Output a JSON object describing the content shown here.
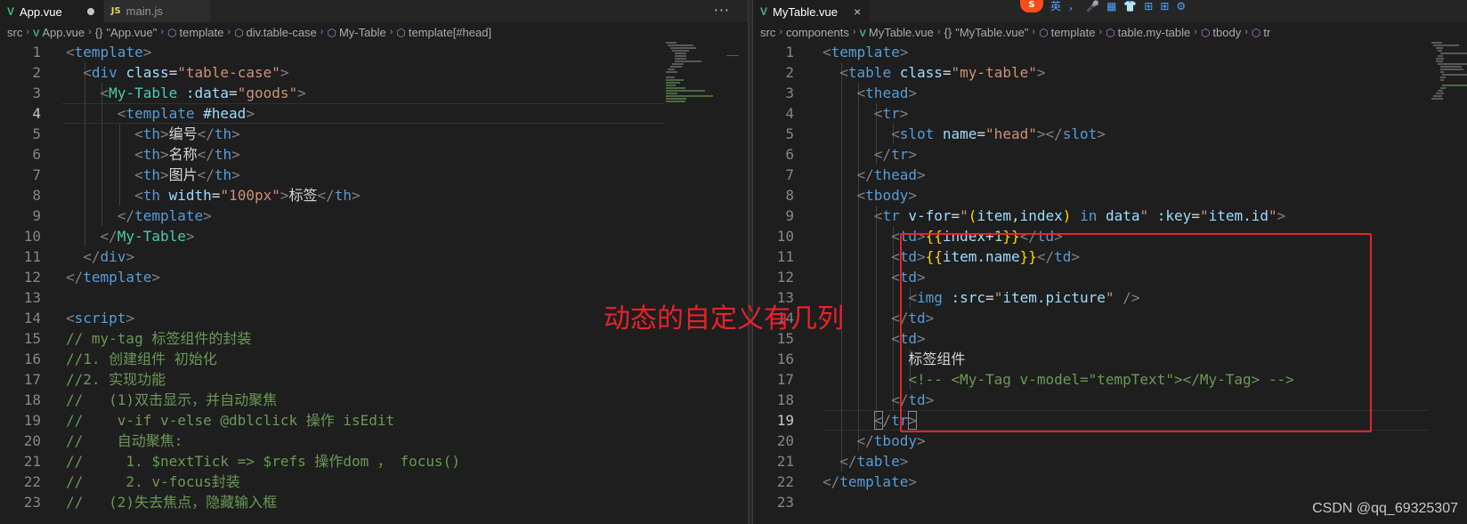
{
  "left": {
    "tabs": [
      {
        "label": "App.vue",
        "icon": "V",
        "modified": true,
        "active": true
      },
      {
        "label": "main.js",
        "icon": "JS",
        "active": false
      }
    ],
    "more": "···",
    "breadcrumb": [
      {
        "text": "src",
        "kind": "plain"
      },
      {
        "text": "App.vue",
        "kind": "vue"
      },
      {
        "text": "\"App.vue\"",
        "kind": "brace"
      },
      {
        "text": "template",
        "kind": "cube"
      },
      {
        "text": "div.table-case",
        "kind": "cube"
      },
      {
        "text": "My-Table",
        "kind": "cube"
      },
      {
        "text": "template[#head]",
        "kind": "cube"
      }
    ],
    "current_line": 4,
    "lines": [
      {
        "n": "1",
        "t": [
          [
            "br",
            "<"
          ],
          [
            "tag",
            "template"
          ],
          [
            "br",
            ">"
          ]
        ]
      },
      {
        "n": "2",
        "t": [
          [
            "txt",
            "  "
          ],
          [
            "br",
            "<"
          ],
          [
            "tag",
            "div"
          ],
          [
            "txt",
            " "
          ],
          [
            "attr",
            "class"
          ],
          [
            "txt",
            "="
          ],
          [
            "str",
            "\"table-case\""
          ],
          [
            "br",
            ">"
          ]
        ]
      },
      {
        "n": "3",
        "t": [
          [
            "txt",
            "    "
          ],
          [
            "br",
            "<"
          ],
          [
            "comp",
            "My-Table"
          ],
          [
            "txt",
            " "
          ],
          [
            "attr",
            ":data"
          ],
          [
            "txt",
            "="
          ],
          [
            "str",
            "\"goods\""
          ],
          [
            "br",
            ">"
          ]
        ]
      },
      {
        "n": "4",
        "t": [
          [
            "txt",
            "      "
          ],
          [
            "br",
            "<"
          ],
          [
            "tag",
            "template"
          ],
          [
            "txt",
            " "
          ],
          [
            "attr",
            "#head"
          ],
          [
            "br",
            ">"
          ]
        ]
      },
      {
        "n": "5",
        "t": [
          [
            "txt",
            "        "
          ],
          [
            "br",
            "<"
          ],
          [
            "tag",
            "th"
          ],
          [
            "br",
            ">"
          ],
          [
            "txt",
            "编号"
          ],
          [
            "br",
            "</"
          ],
          [
            "tag",
            "th"
          ],
          [
            "br",
            ">"
          ]
        ]
      },
      {
        "n": "6",
        "t": [
          [
            "txt",
            "        "
          ],
          [
            "br",
            "<"
          ],
          [
            "tag",
            "th"
          ],
          [
            "br",
            ">"
          ],
          [
            "txt",
            "名称"
          ],
          [
            "br",
            "</"
          ],
          [
            "tag",
            "th"
          ],
          [
            "br",
            ">"
          ]
        ]
      },
      {
        "n": "7",
        "t": [
          [
            "txt",
            "        "
          ],
          [
            "br",
            "<"
          ],
          [
            "tag",
            "th"
          ],
          [
            "br",
            ">"
          ],
          [
            "txt",
            "图片"
          ],
          [
            "br",
            "</"
          ],
          [
            "tag",
            "th"
          ],
          [
            "br",
            ">"
          ]
        ]
      },
      {
        "n": "8",
        "t": [
          [
            "txt",
            "        "
          ],
          [
            "br",
            "<"
          ],
          [
            "tag",
            "th"
          ],
          [
            "txt",
            " "
          ],
          [
            "attr",
            "width"
          ],
          [
            "txt",
            "="
          ],
          [
            "str",
            "\"100px\""
          ],
          [
            "br",
            ">"
          ],
          [
            "txt",
            "标签"
          ],
          [
            "br",
            "</"
          ],
          [
            "tag",
            "th"
          ],
          [
            "br",
            ">"
          ]
        ]
      },
      {
        "n": "9",
        "t": [
          [
            "txt",
            "      "
          ],
          [
            "br",
            "</"
          ],
          [
            "tag",
            "template"
          ],
          [
            "br",
            ">"
          ]
        ]
      },
      {
        "n": "10",
        "t": [
          [
            "txt",
            "    "
          ],
          [
            "br",
            "</"
          ],
          [
            "comp",
            "My-Table"
          ],
          [
            "br",
            ">"
          ]
        ]
      },
      {
        "n": "11",
        "t": [
          [
            "txt",
            "  "
          ],
          [
            "br",
            "</"
          ],
          [
            "tag",
            "div"
          ],
          [
            "br",
            ">"
          ]
        ]
      },
      {
        "n": "12",
        "t": [
          [
            "br",
            "</"
          ],
          [
            "tag",
            "template"
          ],
          [
            "br",
            ">"
          ]
        ]
      },
      {
        "n": "13",
        "t": []
      },
      {
        "n": "14",
        "t": [
          [
            "br",
            "<"
          ],
          [
            "tag",
            "script"
          ],
          [
            "br",
            ">"
          ]
        ]
      },
      {
        "n": "15",
        "t": [
          [
            "com",
            "// my-tag 标签组件的封装"
          ]
        ]
      },
      {
        "n": "16",
        "t": [
          [
            "com",
            "//1. 创建组件 初始化"
          ]
        ]
      },
      {
        "n": "17",
        "t": [
          [
            "com",
            "//2. 实现功能"
          ]
        ]
      },
      {
        "n": "18",
        "t": [
          [
            "com",
            "//   (1)双击显示，并自动聚焦"
          ]
        ]
      },
      {
        "n": "19",
        "t": [
          [
            "com",
            "//    v-if v-else @dblclick 操作 isEdit"
          ]
        ]
      },
      {
        "n": "20",
        "t": [
          [
            "com",
            "//    自动聚焦:"
          ]
        ]
      },
      {
        "n": "21",
        "t": [
          [
            "com",
            "//     1. $nextTick => $refs 操作dom ， focus()"
          ]
        ]
      },
      {
        "n": "22",
        "t": [
          [
            "com",
            "//     2. v-focus封装"
          ]
        ]
      },
      {
        "n": "23",
        "t": [
          [
            "com",
            "//   (2)失去焦点，隐藏输入框"
          ]
        ]
      }
    ]
  },
  "right": {
    "tabs": [
      {
        "label": "MyTable.vue",
        "icon": "V",
        "active": true
      }
    ],
    "close": "×",
    "ime": {
      "logo": "S",
      "items": [
        "英",
        "，",
        "🎤",
        "▦",
        "👕",
        "⊞",
        "⊞",
        "⚙"
      ]
    },
    "breadcrumb": [
      {
        "text": "src",
        "kind": "plain"
      },
      {
        "text": "components",
        "kind": "plain"
      },
      {
        "text": "MyTable.vue",
        "kind": "vue"
      },
      {
        "text": "\"MyTable.vue\"",
        "kind": "brace"
      },
      {
        "text": "template",
        "kind": "cube"
      },
      {
        "text": "table.my-table",
        "kind": "cube"
      },
      {
        "text": "tbody",
        "kind": "cube"
      },
      {
        "text": "tr",
        "kind": "cube"
      }
    ],
    "current_line": 19,
    "lines": [
      {
        "n": "1",
        "t": [
          [
            "br",
            "<"
          ],
          [
            "tag",
            "template"
          ],
          [
            "br",
            ">"
          ]
        ]
      },
      {
        "n": "2",
        "t": [
          [
            "txt",
            "  "
          ],
          [
            "br",
            "<"
          ],
          [
            "tag",
            "table"
          ],
          [
            "txt",
            " "
          ],
          [
            "attr",
            "class"
          ],
          [
            "txt",
            "="
          ],
          [
            "str",
            "\"my-table\""
          ],
          [
            "br",
            ">"
          ]
        ]
      },
      {
        "n": "3",
        "t": [
          [
            "txt",
            "    "
          ],
          [
            "br",
            "<"
          ],
          [
            "tag",
            "thead"
          ],
          [
            "br",
            ">"
          ]
        ]
      },
      {
        "n": "4",
        "t": [
          [
            "txt",
            "      "
          ],
          [
            "br",
            "<"
          ],
          [
            "tag",
            "tr"
          ],
          [
            "br",
            ">"
          ]
        ]
      },
      {
        "n": "5",
        "t": [
          [
            "txt",
            "        "
          ],
          [
            "br",
            "<"
          ],
          [
            "tag",
            "slot"
          ],
          [
            "txt",
            " "
          ],
          [
            "attr",
            "name"
          ],
          [
            "txt",
            "="
          ],
          [
            "str",
            "\"head\""
          ],
          [
            "br",
            "></"
          ],
          [
            "tag",
            "slot"
          ],
          [
            "br",
            ">"
          ]
        ]
      },
      {
        "n": "6",
        "t": [
          [
            "txt",
            "      "
          ],
          [
            "br",
            "</"
          ],
          [
            "tag",
            "tr"
          ],
          [
            "br",
            ">"
          ]
        ]
      },
      {
        "n": "7",
        "t": [
          [
            "txt",
            "    "
          ],
          [
            "br",
            "</"
          ],
          [
            "tag",
            "thead"
          ],
          [
            "br",
            ">"
          ]
        ]
      },
      {
        "n": "8",
        "t": [
          [
            "txt",
            "    "
          ],
          [
            "br",
            "<"
          ],
          [
            "tag",
            "tbody"
          ],
          [
            "br",
            ">"
          ]
        ]
      },
      {
        "n": "9",
        "t": [
          [
            "txt",
            "      "
          ],
          [
            "br",
            "<"
          ],
          [
            "tag",
            "tr"
          ],
          [
            "txt",
            " "
          ],
          [
            "attr",
            "v-for"
          ],
          [
            "txt",
            "="
          ],
          [
            "str",
            "\""
          ],
          [
            "mus",
            "("
          ],
          [
            "var",
            "item"
          ],
          [
            "txt",
            ","
          ],
          [
            "var",
            "index"
          ],
          [
            "mus",
            ")"
          ],
          [
            "txt",
            " "
          ],
          [
            "kw",
            "in"
          ],
          [
            "txt",
            " "
          ],
          [
            "var",
            "data"
          ],
          [
            "str",
            "\""
          ],
          [
            "txt",
            " "
          ],
          [
            "attr",
            ":key"
          ],
          [
            "txt",
            "="
          ],
          [
            "str",
            "\""
          ],
          [
            "var",
            "item.id"
          ],
          [
            "str",
            "\""
          ],
          [
            "br",
            ">"
          ]
        ]
      },
      {
        "n": "10",
        "t": [
          [
            "txt",
            "        "
          ],
          [
            "br",
            "<"
          ],
          [
            "tag",
            "td"
          ],
          [
            "br",
            ">"
          ],
          [
            "mus",
            "{{"
          ],
          [
            "var",
            "index"
          ],
          [
            "txt",
            "+"
          ],
          [
            "num",
            "1"
          ],
          [
            "mus",
            "}}"
          ],
          [
            "br",
            "</"
          ],
          [
            "tag",
            "td"
          ],
          [
            "br",
            ">"
          ]
        ]
      },
      {
        "n": "11",
        "t": [
          [
            "txt",
            "        "
          ],
          [
            "br",
            "<"
          ],
          [
            "tag",
            "td"
          ],
          [
            "br",
            ">"
          ],
          [
            "mus",
            "{{"
          ],
          [
            "var",
            "item.name"
          ],
          [
            "mus",
            "}}"
          ],
          [
            "br",
            "</"
          ],
          [
            "tag",
            "td"
          ],
          [
            "br",
            ">"
          ]
        ]
      },
      {
        "n": "12",
        "t": [
          [
            "txt",
            "        "
          ],
          [
            "br",
            "<"
          ],
          [
            "tag",
            "td"
          ],
          [
            "br",
            ">"
          ]
        ]
      },
      {
        "n": "13",
        "t": [
          [
            "txt",
            "          "
          ],
          [
            "br",
            "<"
          ],
          [
            "tag",
            "img"
          ],
          [
            "txt",
            " "
          ],
          [
            "attr",
            ":src"
          ],
          [
            "txt",
            "="
          ],
          [
            "str",
            "\""
          ],
          [
            "var",
            "item.picture"
          ],
          [
            "str",
            "\""
          ],
          [
            "txt",
            " "
          ],
          [
            "br",
            "/>"
          ]
        ]
      },
      {
        "n": "14",
        "t": [
          [
            "txt",
            "        "
          ],
          [
            "br",
            "</"
          ],
          [
            "tag",
            "td"
          ],
          [
            "br",
            ">"
          ]
        ]
      },
      {
        "n": "15",
        "t": [
          [
            "txt",
            "        "
          ],
          [
            "br",
            "<"
          ],
          [
            "tag",
            "td"
          ],
          [
            "br",
            ">"
          ]
        ]
      },
      {
        "n": "16",
        "t": [
          [
            "txt",
            "          标签组件"
          ]
        ]
      },
      {
        "n": "17",
        "t": [
          [
            "txt",
            "          "
          ],
          [
            "com",
            "<!-- <My-Tag v-model=\"tempText\"></My-Tag> -->"
          ]
        ]
      },
      {
        "n": "18",
        "t": [
          [
            "txt",
            "        "
          ],
          [
            "br",
            "</"
          ],
          [
            "tag",
            "td"
          ],
          [
            "br",
            ">"
          ]
        ]
      },
      {
        "n": "19",
        "t": [
          [
            "txt",
            "      "
          ],
          [
            "br",
            "</"
          ],
          [
            "tag",
            "tr"
          ],
          [
            "br",
            ">"
          ]
        ]
      },
      {
        "n": "20",
        "t": [
          [
            "txt",
            "    "
          ],
          [
            "br",
            "</"
          ],
          [
            "tag",
            "tbody"
          ],
          [
            "br",
            ">"
          ]
        ]
      },
      {
        "n": "21",
        "t": [
          [
            "txt",
            "  "
          ],
          [
            "br",
            "</"
          ],
          [
            "tag",
            "table"
          ],
          [
            "br",
            ">"
          ]
        ]
      },
      {
        "n": "22",
        "t": [
          [
            "br",
            "</"
          ],
          [
            "tag",
            "template"
          ],
          [
            "br",
            ">"
          ]
        ]
      },
      {
        "n": "23",
        "t": []
      }
    ]
  },
  "annotation": "动态的自定义有几列",
  "watermark": "CSDN @qq_69325307",
  "colors": {
    "annotation": "#e8222a",
    "vue": "#41b883",
    "js": "#e8d44d"
  }
}
